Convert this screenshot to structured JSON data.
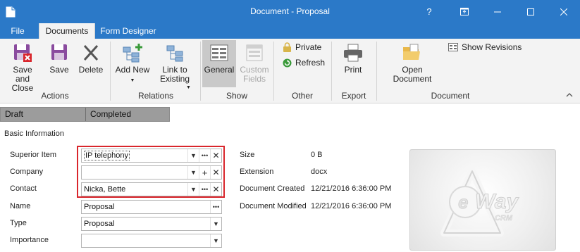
{
  "window": {
    "title": "Document - Proposal",
    "help": "?",
    "restore": "⧉",
    "minimize": "—",
    "maximize": "☐",
    "close": "✕"
  },
  "tabs": [
    {
      "label": "File"
    },
    {
      "label": "Documents"
    },
    {
      "label": "Form Designer"
    }
  ],
  "ribbon": {
    "actions": {
      "save_close": "Save and Close",
      "save": "Save",
      "delete": "Delete",
      "group": "Actions"
    },
    "relations": {
      "add_new": "Add New",
      "link_existing": "Link to Existing",
      "group": "Relations"
    },
    "show": {
      "general": "General",
      "custom_fields": "Custom Fields",
      "group": "Show"
    },
    "other": {
      "private": "Private",
      "refresh": "Refresh",
      "group": "Other"
    },
    "export": {
      "print": "Print",
      "group": "Export"
    },
    "document": {
      "open": "Open Document",
      "show_revisions": "Show Revisions",
      "group": "Document"
    }
  },
  "status_strip": [
    {
      "label": "Draft"
    },
    {
      "label": "Completed"
    }
  ],
  "form": {
    "section": "Basic Information",
    "fields": [
      {
        "label": "Superior Item",
        "value": "IP telephony"
      },
      {
        "label": "Company",
        "value": ""
      },
      {
        "label": "Contact",
        "value": "Nicka, Bette"
      },
      {
        "label": "Name",
        "value": "Proposal"
      },
      {
        "label": "Type",
        "value": "Proposal"
      },
      {
        "label": "Importance",
        "value": ""
      }
    ]
  },
  "properties": [
    {
      "label": "Size",
      "value": "0 B"
    },
    {
      "label": "Extension",
      "value": "docx"
    },
    {
      "label": "Document Created",
      "value": "12/21/2016 6:36:00 PM"
    },
    {
      "label": "Document Modified",
      "value": "12/21/2016 6:36:00 PM"
    }
  ],
  "preview_logo": "eWay CRM",
  "colors": {
    "accent": "#2b79c8",
    "highlight": "#d9262c"
  }
}
